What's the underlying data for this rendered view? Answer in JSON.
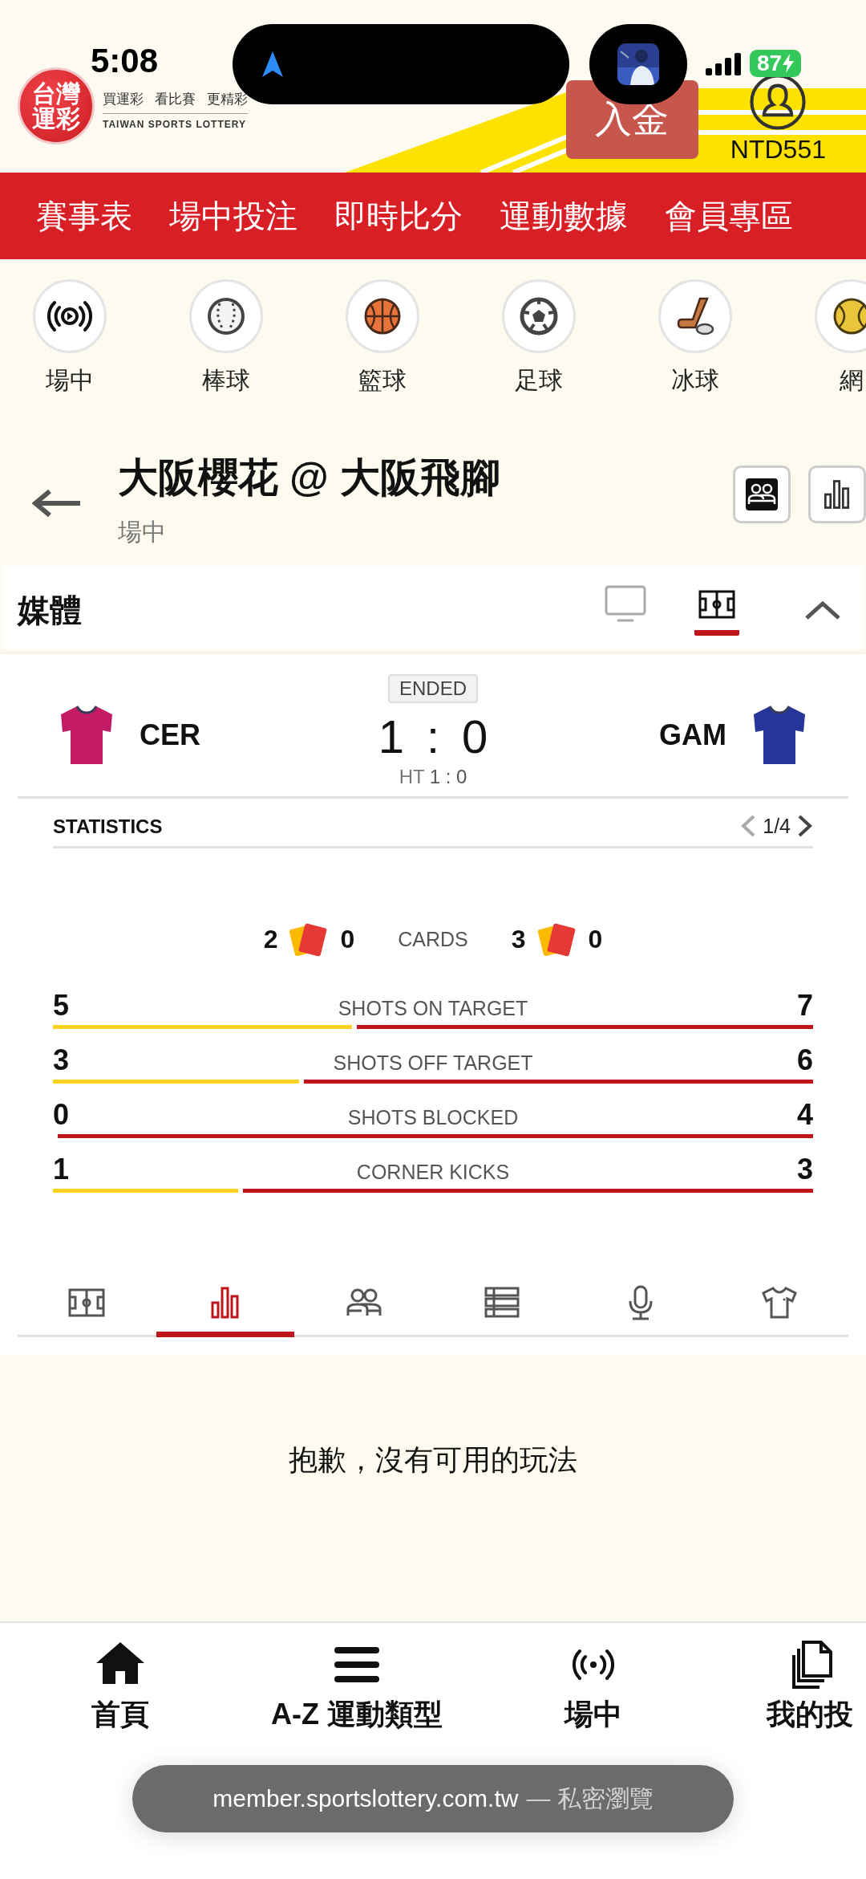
{
  "status_bar": {
    "time": "5:08",
    "battery": "87"
  },
  "header": {
    "logo": [
      "台灣",
      "運彩"
    ],
    "slogan": [
      "買運彩",
      "看比賽",
      "更精彩"
    ],
    "subtitle": "TAIWAN SPORTS LOTTERY",
    "deposit_button": "入金",
    "balance": "NTD551"
  },
  "nav": [
    "賽事表",
    "場中投注",
    "即時比分",
    "運動數據",
    "會員專區"
  ],
  "sports": [
    {
      "kind": "live",
      "label": "場中"
    },
    {
      "kind": "baseball",
      "label": "棒球"
    },
    {
      "kind": "basketball",
      "label": "籃球"
    },
    {
      "kind": "soccer",
      "label": "足球"
    },
    {
      "kind": "hockey",
      "label": "冰球"
    },
    {
      "kind": "tennis",
      "label": "網"
    }
  ],
  "match": {
    "title": "大阪櫻花 @ 大阪飛腳",
    "subtitle": "場中"
  },
  "media": {
    "title": "媒體",
    "expanded": true,
    "views": [
      {
        "kind": "tv",
        "selected": false
      },
      {
        "kind": "pitch",
        "selected": true
      }
    ]
  },
  "scoreboard": {
    "status": "ENDED",
    "teams": [
      {
        "name": "CER",
        "color": "#c41c64"
      },
      {
        "name": "GAM",
        "color": "#263597"
      }
    ],
    "score_home": "1",
    "separator": ":",
    "score_away": "0",
    "halftime_label": "HT",
    "halftime_score": "1 : 0"
  },
  "statistics": {
    "title": "STATISTICS",
    "page": "1/4",
    "cards": {
      "label": "CARDS",
      "home_yellow": "2",
      "home_red": "0",
      "away_yellow": "3",
      "away_red": "0"
    },
    "rows": [
      {
        "label": "SHOTS ON TARGET",
        "home": "5",
        "away": "7",
        "level": 0.4
      },
      {
        "label": "SHOTS OFF TARGET",
        "home": "3",
        "away": "6",
        "level": 0.33
      },
      {
        "label": "SHOTS BLOCKED",
        "home": "0",
        "away": "4",
        "level": 0
      },
      {
        "label": "CORNER KICKS",
        "home": "1",
        "away": "3",
        "level": 0.25
      }
    ]
  },
  "tabs": [
    {
      "kind": "pitch",
      "selected": false
    },
    {
      "kind": "stats",
      "selected": true
    },
    {
      "kind": "lineup",
      "selected": false
    },
    {
      "kind": "list",
      "selected": false
    },
    {
      "kind": "commentary",
      "selected": false
    },
    {
      "kind": "kit",
      "selected": false
    }
  ],
  "empty_message": "抱歉，沒有可用的玩法",
  "bottom_nav": [
    {
      "kind": "home",
      "label": "首頁"
    },
    {
      "kind": "menu",
      "label": "A-Z 運動類型"
    },
    {
      "kind": "live",
      "label": "場中"
    },
    {
      "kind": "bets",
      "label": "我的投"
    }
  ],
  "browser": {
    "url": "member.sportslottery.com.tw",
    "mode": "— 私密瀏覽"
  }
}
